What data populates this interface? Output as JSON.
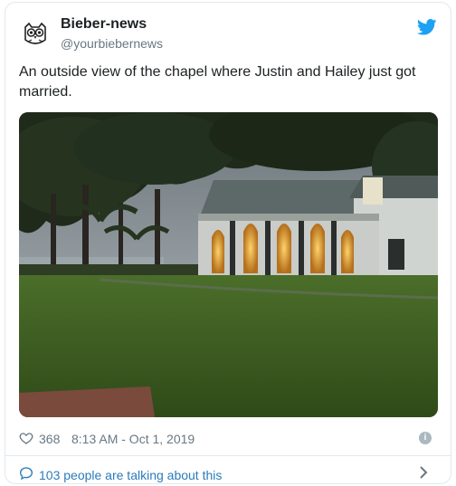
{
  "user": {
    "name": "Bieber-news",
    "handle": "@yourbiebernews"
  },
  "tweet": {
    "text": "An outside view of the chapel where Justin and Hailey just got married."
  },
  "meta": {
    "likes": "368",
    "timestamp": "8:13 AM - Oct 1, 2019",
    "info_glyph": "i"
  },
  "footer": {
    "talking": "103 people are talking about this"
  },
  "colors": {
    "twitter_blue": "#1da1f2",
    "link_blue": "#2b7bb9",
    "muted": "#697882"
  },
  "icons": [
    "owl-avatar",
    "twitter-bird-icon",
    "heart-icon",
    "info-icon",
    "comment-bubble-icon",
    "chevron-right-icon"
  ]
}
